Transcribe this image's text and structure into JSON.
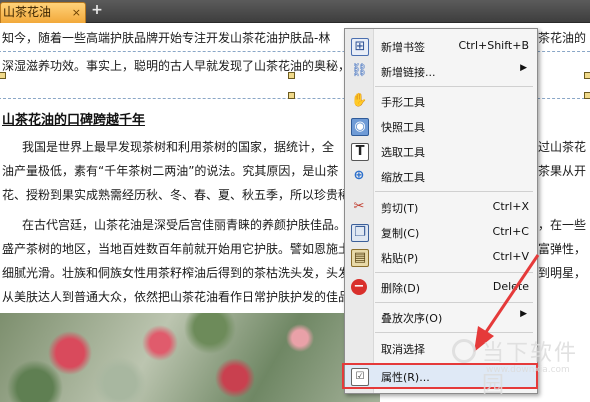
{
  "tab": {
    "title": "山茶花油",
    "close": "×",
    "add": "+"
  },
  "document": {
    "line1": "知今，随着一些高端护肤品牌开始专注开发山茶花油护肤品-林",
    "line1_right": "茶花油的",
    "line2": "深湿滋养功效。事实上，聪明的古人早就发现了山茶花油的奥秘，",
    "heading": "山茶花油的口碑跨越千年",
    "p1_l1": "我国是世界上最早发现茶树和利用茶树的国家，据统计，全",
    "p1_l1_right": "过山茶花",
    "p1_l2": "油产量极低，素有“千年茶树二两油”的说法。究其原因，是山茶",
    "p1_l2_right": "茶果从开",
    "p1_l3": "花、授粉到果实成熟需经历秋、冬、春、夏、秋五季，所以珍贵稀",
    "p2_l1": "在古代宫廷，山茶花油是深受后宫佳丽青睐的养颜护肤佳品。",
    "p2_l1_right": "，在一些",
    "p2_l2": "盛产茶树的地区，当地百姓数百年前就开始用它护肤。譬如恩施土",
    "p2_l2_right": "富弹性，",
    "p2_l3": "细腻光滑。壮族和侗族女性用茶籽榨油后得到的茶枯洗头发，头发",
    "p2_l3_right": "到明星，",
    "p2_l4": "从美肤达人到普通大众，依然把山茶花油看作日常护肤护发的佳品"
  },
  "context_menu": {
    "items": [
      {
        "label": "新增书签",
        "shortcut": "Ctrl+Shift+B",
        "icon": "bookmark-add-icon"
      },
      {
        "label": "新增链接...",
        "shortcut": "",
        "submenu": true,
        "icon": "link-add-icon"
      },
      {
        "label": "手形工具",
        "shortcut": "",
        "icon": "hand-icon"
      },
      {
        "label": "快照工具",
        "shortcut": "",
        "icon": "camera-icon"
      },
      {
        "label": "选取工具",
        "shortcut": "",
        "icon": "select-text-icon"
      },
      {
        "label": "缩放工具",
        "shortcut": "",
        "icon": "zoom-icon"
      },
      {
        "label": "剪切(T)",
        "shortcut": "Ctrl+X",
        "icon": "scissors-icon"
      },
      {
        "label": "复制(C)",
        "shortcut": "Ctrl+C",
        "icon": "copy-icon"
      },
      {
        "label": "粘贴(P)",
        "shortcut": "Ctrl+V",
        "icon": "paste-icon"
      },
      {
        "label": "删除(D)",
        "shortcut": "Delete",
        "icon": "delete-icon"
      },
      {
        "label": "叠放次序(O)",
        "shortcut": "",
        "submenu": true
      },
      {
        "label": "取消选择",
        "shortcut": ""
      },
      {
        "label": "属性(R)...",
        "shortcut": "",
        "icon": "properties-icon"
      }
    ],
    "submenu_arrow": "▶"
  },
  "watermark": {
    "text": "当下软件园",
    "url": "www.downxia.com"
  },
  "colors": {
    "highlight_box": "#e53a3a",
    "arrow": "#e53a3a",
    "tab": "#f2a93a"
  }
}
